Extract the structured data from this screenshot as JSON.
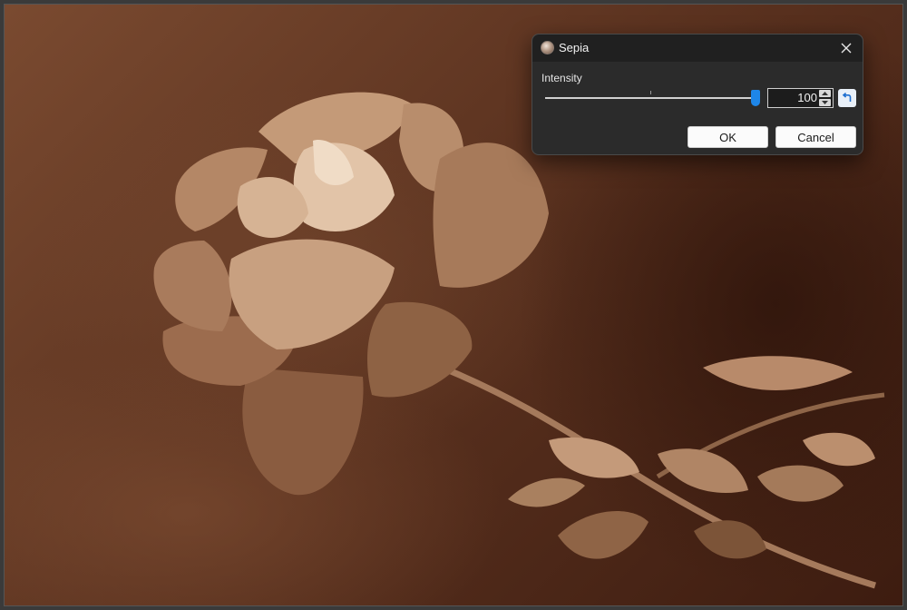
{
  "dialog": {
    "title": "Sepia",
    "app_icon": "sepia-effect-icon",
    "close_icon": "close-icon",
    "intensity_label": "Intensity",
    "intensity_value": "100",
    "intensity_min": 0,
    "intensity_max": 100,
    "intensity_fraction": 1.0,
    "reset_icon": "undo-icon",
    "ok_label": "OK",
    "cancel_label": "Cancel",
    "accent_color": "#1e86e8"
  },
  "canvas": {
    "image_subject": "rose-photo-sepia"
  }
}
